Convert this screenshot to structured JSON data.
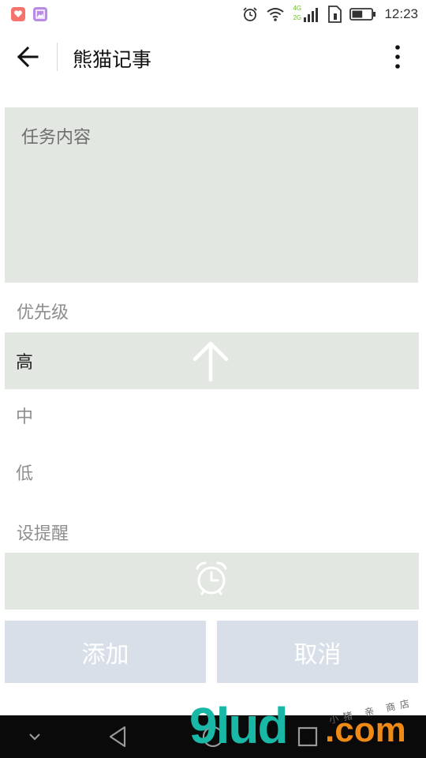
{
  "status_bar": {
    "time": "12:23",
    "network_4g": "4G",
    "network_2g": "2G",
    "icons": [
      "app-notification-icon",
      "gallery-app-icon",
      "alarm-icon",
      "wifi-icon",
      "signal-icon",
      "sim-icon",
      "battery-icon"
    ],
    "battery_level": 0.55
  },
  "app_bar": {
    "title": "熊猫记事",
    "icons": [
      "back-arrow-icon",
      "more-vertical-icon"
    ]
  },
  "task_input": {
    "placeholder": "任务内容",
    "value": ""
  },
  "priority": {
    "label": "优先级",
    "options": [
      {
        "label": "高",
        "selected": true,
        "icon": "up-arrow-icon"
      },
      {
        "label": "中",
        "selected": false
      },
      {
        "label": "低",
        "selected": false
      }
    ]
  },
  "reminder": {
    "label": "设提醒",
    "icon": "alarm-clock-icon"
  },
  "actions": {
    "add_label": "添加",
    "cancel_label": "取消"
  },
  "nav_bar": {
    "icons": [
      "collapse-chevron-icon",
      "back-triangle-icon",
      "home-circle-icon",
      "recents-square-icon"
    ]
  },
  "watermark": {
    "main": "9lud",
    "suffix": ".com",
    "small": "小猪 亲 商店"
  },
  "colors": {
    "field_bg": "#e3e7e1",
    "button_bg": "#d9dfe8",
    "placeholder": "#8e8e8e",
    "nav_bg": "#0a0a0a"
  }
}
